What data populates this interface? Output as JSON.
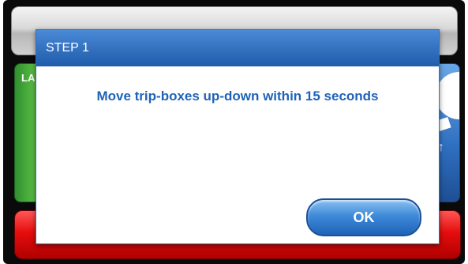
{
  "background": {
    "left_panel_label": "LA"
  },
  "dialog": {
    "title": "STEP 1",
    "message": "Move trip-boxes up-down within 15 seconds",
    "ok_label": "OK"
  },
  "colors": {
    "header_blue": "#1f5cab",
    "message_blue": "#1f63b8",
    "bottom_bar_red": "#e60d0d",
    "left_panel_green": "#6ccf4c"
  },
  "icons": {
    "right_panel_arrow": "up-arrow-icon"
  }
}
